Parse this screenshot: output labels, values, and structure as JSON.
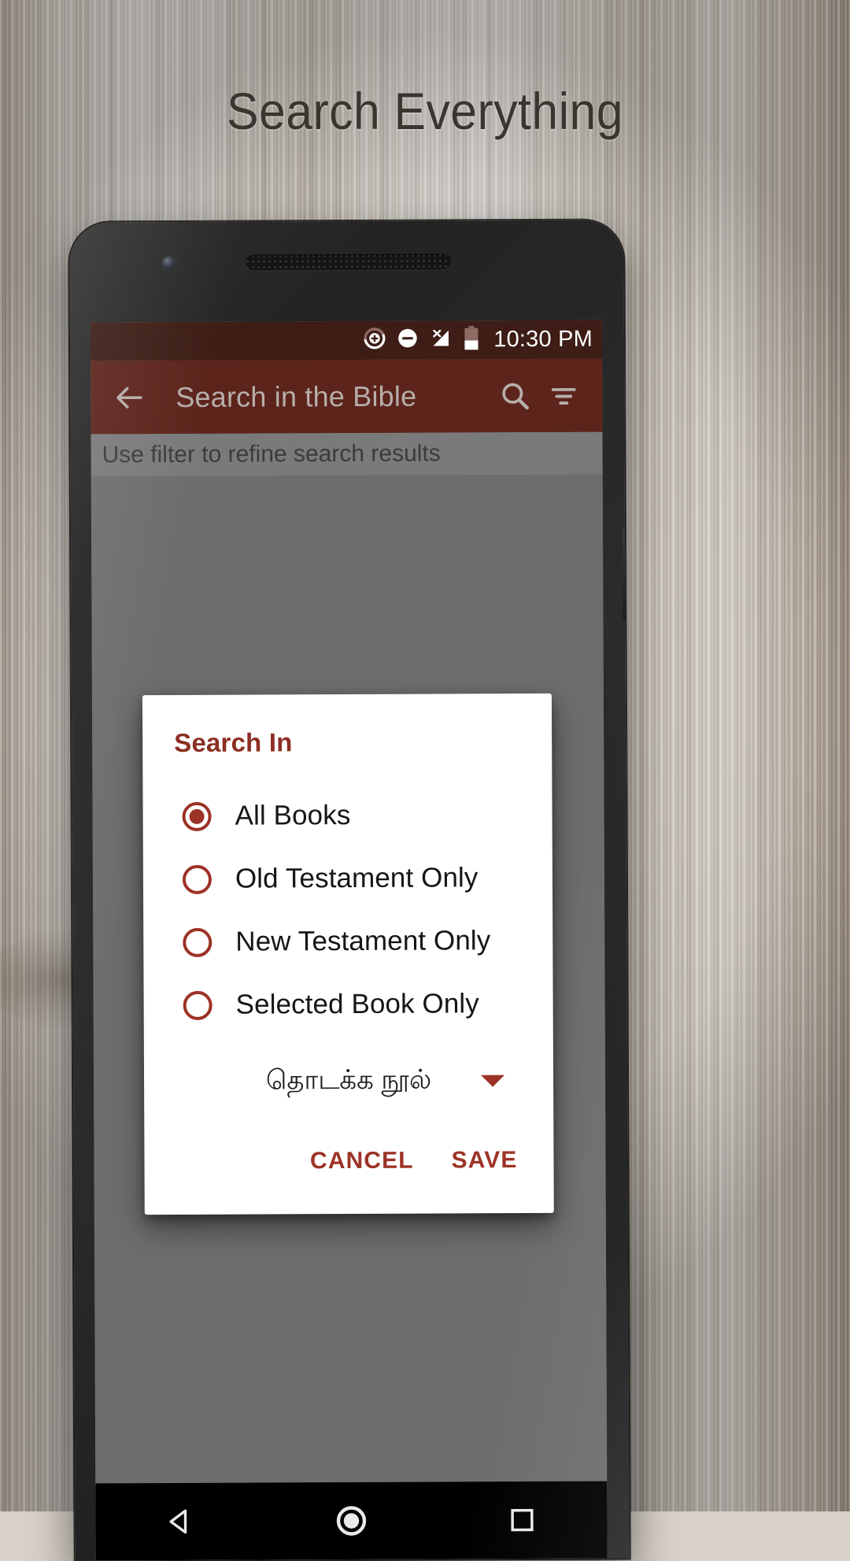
{
  "headline": "Search Everything",
  "status_bar": {
    "time": "10:30 PM",
    "icons": [
      "sync-plus-icon",
      "do-not-disturb-icon",
      "signal-no-service-icon",
      "battery-low-icon"
    ]
  },
  "app_bar": {
    "back_icon": "arrow-left-icon",
    "title": "Search in the Bible",
    "search_icon": "search-icon",
    "filter_icon": "filter-icon"
  },
  "filter_banner": {
    "text": "Use filter to refine search results"
  },
  "dialog": {
    "title": "Search In",
    "options": [
      {
        "label": "All Books",
        "selected": true
      },
      {
        "label": "Old Testament Only",
        "selected": false
      },
      {
        "label": "New Testament Only",
        "selected": false
      },
      {
        "label": "Selected Book Only",
        "selected": false
      }
    ],
    "book_select": {
      "value": "தொடக்க நூல்",
      "caret_icon": "chevron-down-icon"
    },
    "cancel_label": "CANCEL",
    "save_label": "SAVE"
  },
  "nav_bar": {
    "back_icon": "nav-back-triangle-icon",
    "home_icon": "nav-home-circle-icon",
    "recents_icon": "nav-recents-square-icon"
  },
  "colors": {
    "brand_red": "#9c3326",
    "app_bar": "#5c241b",
    "status_bar": "#3d1d16",
    "scrim": "#6d6d6d"
  }
}
